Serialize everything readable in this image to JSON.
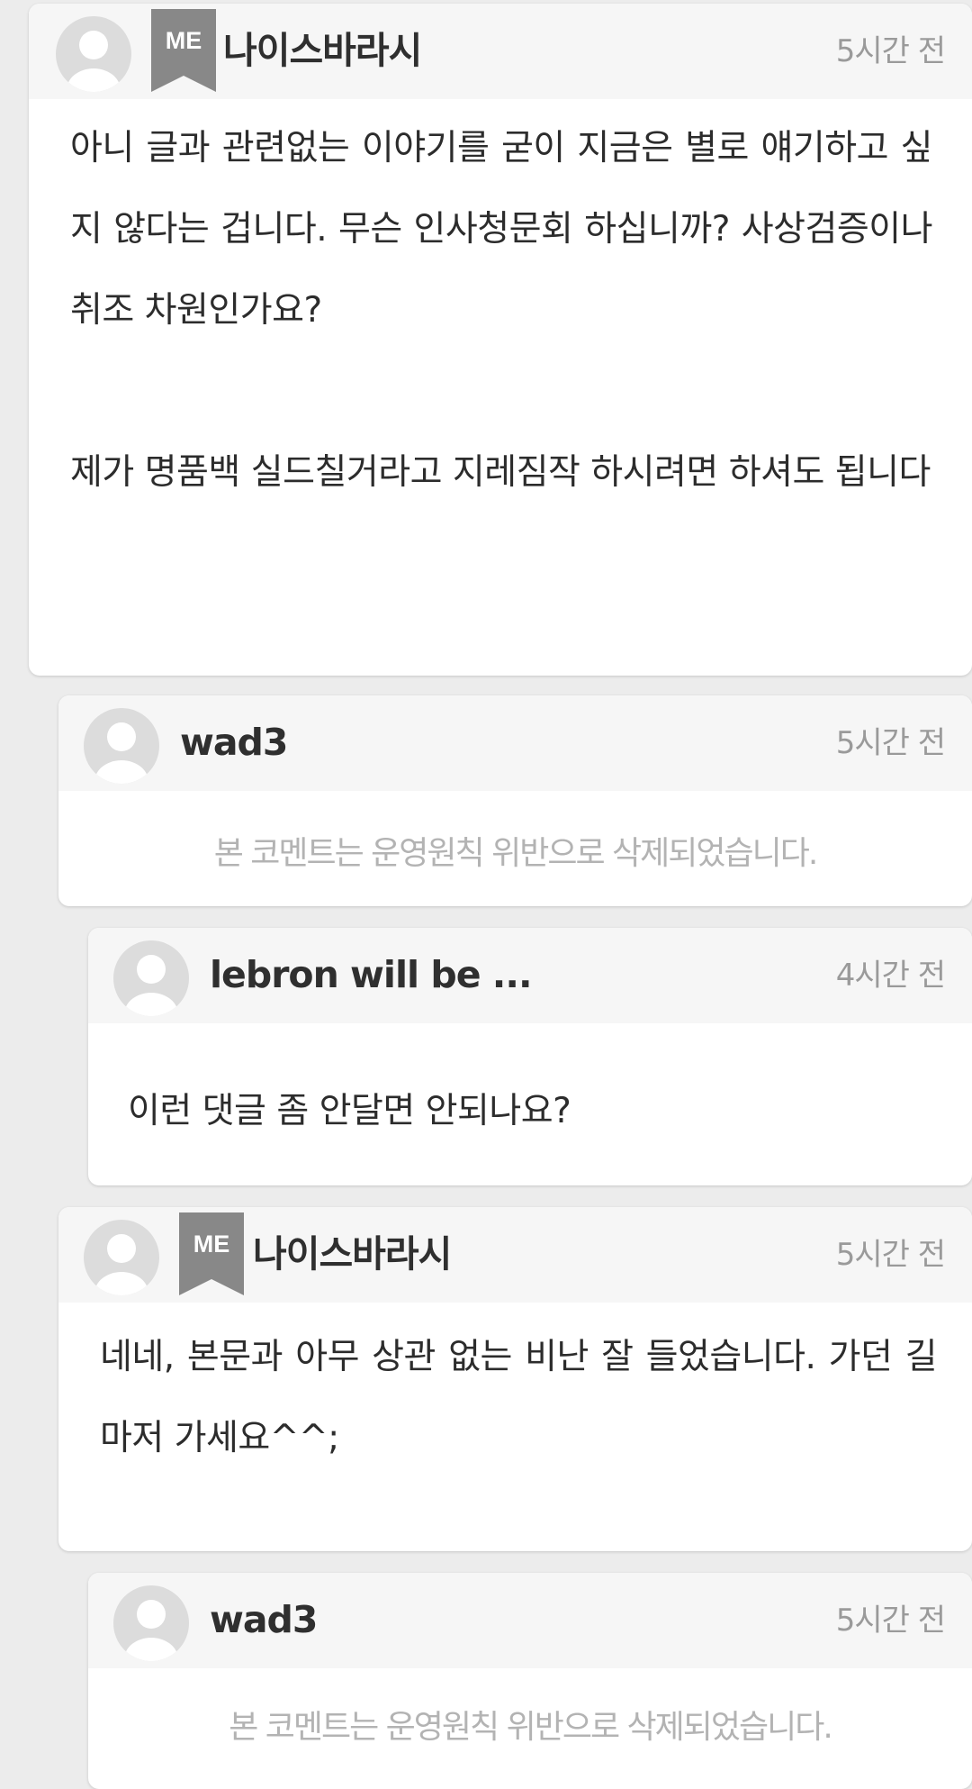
{
  "comments": [
    {
      "author": "나이스바라시",
      "me_badge": "ME",
      "time": "5시간 전",
      "body": "아니 글과 관련없는 이야기를 굳이 지금은 별로 얘기하고 싶지 않다는 겁니다. 무슨 인사청문회 하십니까? 사상검증이나 취조 차원인가요?\n\n제가 명품백 실드칠거라고 지레짐작 하시려면 하셔도 됩니다"
    },
    {
      "author": "wad3",
      "time": "5시간 전",
      "body": "본 코멘트는 운영원칙 위반으로 삭제되었습니다."
    },
    {
      "author": "lebron will be ...",
      "time": "4시간 전",
      "body": "이런 댓글 좀 안달면 안되나요?"
    },
    {
      "author": "나이스바라시",
      "me_badge": "ME",
      "time": "5시간 전",
      "body": "네네, 본문과 아무 상관 없는 비난 잘 들었습니다. 가던 길 마저 가세요^^;"
    },
    {
      "author": "wad3",
      "time": "5시간 전",
      "body": "본 코멘트는 운영원칙 위반으로 삭제되었습니다."
    }
  ]
}
